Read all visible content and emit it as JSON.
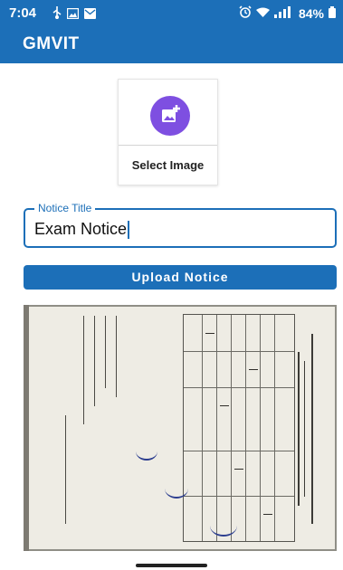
{
  "status_bar": {
    "time": "7:04",
    "left_icons": [
      "usb-icon",
      "image-notification-icon",
      "mail-icon"
    ],
    "right_icons": [
      "alarm-icon",
      "wifi-icon",
      "volte-signal-icon"
    ],
    "battery": "84%",
    "background": "#1c6fb8"
  },
  "app_bar": {
    "title": "GMVIT",
    "background": "#1c6fb8"
  },
  "image_picker": {
    "label": "Select Image",
    "icon": "add-photo-icon",
    "accent": "#7e4fe1"
  },
  "notice_title_field": {
    "label": "Notice Title",
    "value": "Exam Notice"
  },
  "upload_button": {
    "label": "Upload Notice"
  },
  "preview": {
    "description_icon": "uploaded-notice-image"
  }
}
